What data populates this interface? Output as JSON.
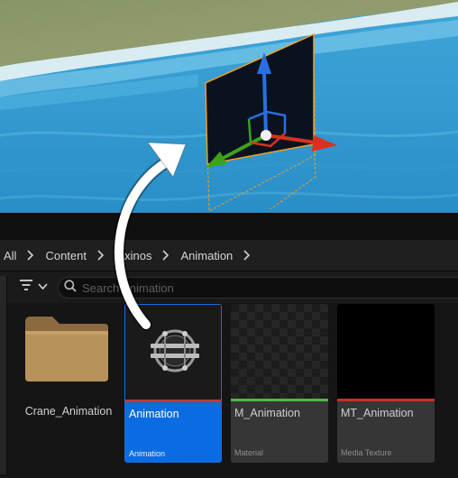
{
  "breadcrumb": {
    "items": [
      "All",
      "Content",
      "laxinos",
      "Animation"
    ]
  },
  "search": {
    "placeholder": "Search Animation"
  },
  "assets": [
    {
      "name": "Crane_Animation",
      "type": ""
    },
    {
      "name": "Animation",
      "type": "Animation"
    },
    {
      "name": "M_Animation",
      "type": "Material"
    },
    {
      "name": "MT_Animation",
      "type": "Media Texture"
    }
  ],
  "colors": {
    "selection": "#0a6ce0",
    "material_bar": "#4fb84a",
    "texture_bar": "#c8302a",
    "animation_bar": "#c23a35",
    "folder": "#b8925a",
    "gizmo_x": "#d8321e",
    "gizmo_y": "#3da21b",
    "gizmo_z": "#2a6fe0",
    "selection_outline": "#f0a020"
  },
  "icons": [
    "filter-icon",
    "chevron-down-icon",
    "search-icon",
    "folder-icon",
    "level-sequence-icon",
    "chevron-right-icon"
  ]
}
